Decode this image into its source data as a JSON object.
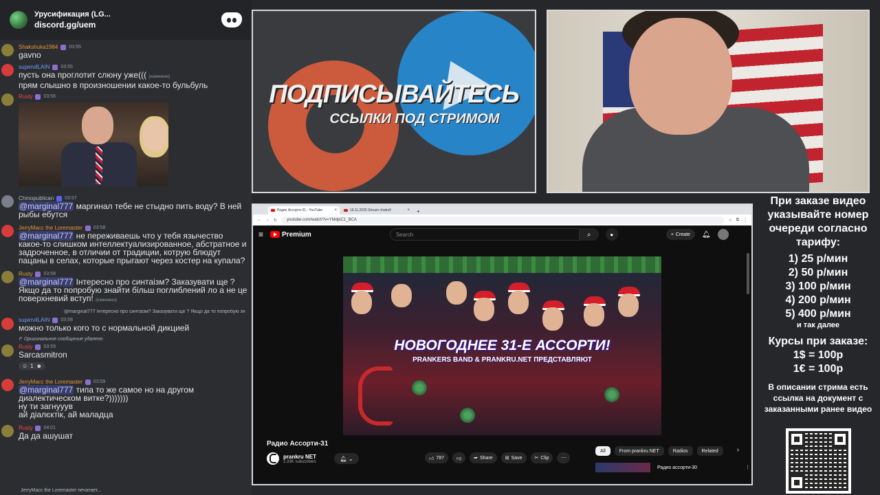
{
  "chat": {
    "server_name": "Урусификация (LG...",
    "server_link": "discord.gg/uem",
    "messages": [
      {
        "author": "Shakshuka1984",
        "time": "03:55",
        "text": "gavno"
      },
      {
        "author": "supervilLAIN",
        "time": "03:55",
        "text": "пусть она проглотит слюну уже(((",
        "edited": "(изменено)",
        "text2": "прям слышно в произношении какое-то бульбуль"
      },
      {
        "author": "Rusty",
        "time": "03:56"
      },
      {
        "author": "Chmopublican",
        "time": "03:57",
        "mention": "@marginal777",
        "text": " маргинал тебе не стыдно пить воду? В ней рыбы ебутся"
      },
      {
        "author": "JerryMacc the Loremaster",
        "time": "03:58",
        "mention": "@marginal777",
        "text": " не переживаешь что у тебя язычество какое-то слишком интеллектуализированное, абстратное и задроченное, в отличии от традиции, котрую блюдут пацаны в селах, которые прыгают через костер на купала?"
      },
      {
        "author": "Rusty",
        "time": "03:58",
        "mention": "@marginal777",
        "text": " Інтересно про синтаізм? Заказувати ще ? Якщо да то попробую знайти більш поглиблений ло а не це поверхневий вступ!",
        "edited": "(изменено)"
      },
      {
        "reply": "@marginal777 Інтересно про синтаізм? Заказувати ще ? Якщо да то попробую зн",
        "author": "supervilLAIN",
        "time": "03:58",
        "text": "можно только кого то с нормальной дикцией"
      },
      {
        "reply": "Оригинальное сообщение удалено",
        "author": "Rusty",
        "time": "03:59",
        "text": "Sarcasmitron",
        "reaction_count": "1"
      },
      {
        "author": "JerryMacc the Loremaster",
        "time": "03:59",
        "mention": "@marginal777",
        "text": " типа то же самое но на другом диалектическом витке?)))))))",
        "text2": "ну ти загнууув",
        "text3": "ай діалєктік, ай маладца"
      },
      {
        "author": "Rusty",
        "time": "04:01",
        "text": "Да да ашушат"
      }
    ],
    "typing": "JerryMacc the Loremaster печатает..."
  },
  "promo": {
    "title": "ПОДПИСЫВАЙТЕСЬ",
    "subtitle": "ССЫЛКИ ПОД СТРИМОМ"
  },
  "browser": {
    "tab1": "Радио Ассорти-31 - YouTube",
    "tab2": "18.11.2025 Stream chatroll",
    "url": "youtube.com/watch?v=YMdpiC1_BCA",
    "yt_logo": "Premium",
    "search_placeholder": "Search",
    "create_label": "Create",
    "video": {
      "title_overlay": "НОВОГОДНЕЕ 31-Е АССОРТИ!",
      "subtitle_overlay": "PRANKERS BAND & PRANKRU.NET ПРЕДСТАВЛЯЮТ",
      "title": "Радио Ассорти-31",
      "channel": "prankru NET",
      "subscribers": "2.33K subscribers",
      "likes": "787",
      "share": "Share",
      "save": "Save",
      "clip": "Clip"
    },
    "chips": [
      "All",
      "From prankru NET",
      "Radios",
      "Related"
    ],
    "recommended": "Радио ассорти-30"
  },
  "info": {
    "intro": "При заказе видео указывайте номер очереди согласно тарифу:",
    "prices": [
      "1) 25 р/мин",
      "2) 50 р/мин",
      "3) 100 р/мин",
      "4) 200 р/мин",
      "5) 400 р/мин"
    ],
    "etc": "и так далее",
    "courses_title": "Курсы при заказе:",
    "rates": [
      "1$ = 100р",
      "1€ = 100р"
    ],
    "note": "В описании стрима есть ссылка на документ с заказанными ранее видео"
  }
}
